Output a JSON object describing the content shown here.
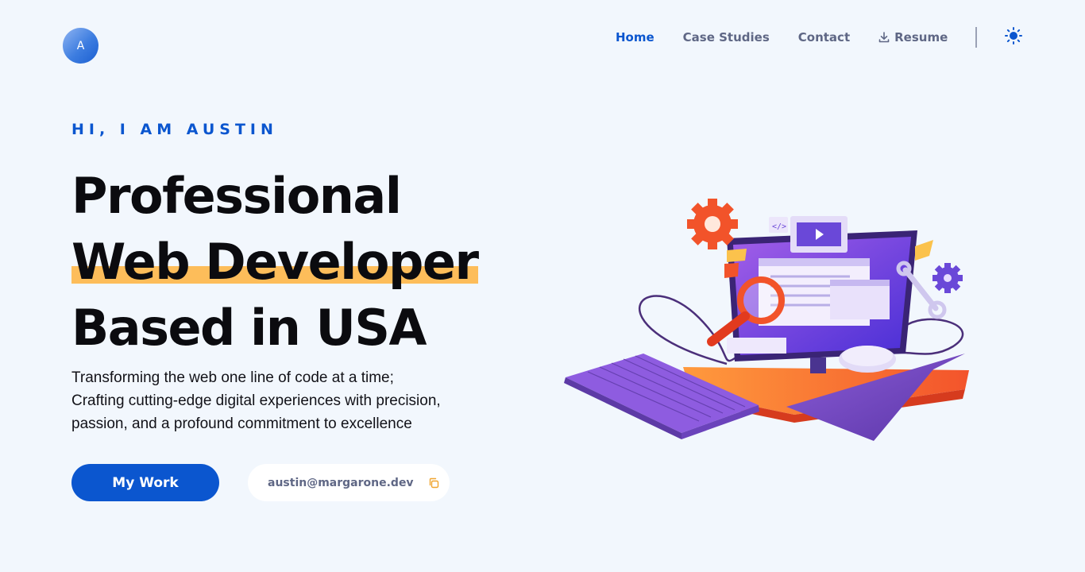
{
  "header": {
    "logo_letter": "A",
    "nav": [
      {
        "label": "Home",
        "active": true
      },
      {
        "label": "Case Studies",
        "active": false
      },
      {
        "label": "Contact",
        "active": false
      },
      {
        "label": "Resume",
        "active": false,
        "icon": "download-icon"
      }
    ],
    "theme_icon": "sun-icon"
  },
  "hero": {
    "eyebrow": "HI, I AM AUSTIN",
    "headline": [
      "Professional",
      "Web Developer",
      "Based in USA"
    ],
    "lead": [
      "Transforming the web one line of code at a time;",
      "Crafting cutting-edge digital experiences with precision,",
      "passion, and a profound commitment to excellence"
    ],
    "cta_label": "My Work",
    "email": "austin@margarone.dev",
    "copy_icon": "copy-icon"
  },
  "colors": {
    "background": "#f2f7fd",
    "accent": "#0b56cf",
    "highlight": "#fdbd5a",
    "muted_text": "#5f6785"
  }
}
